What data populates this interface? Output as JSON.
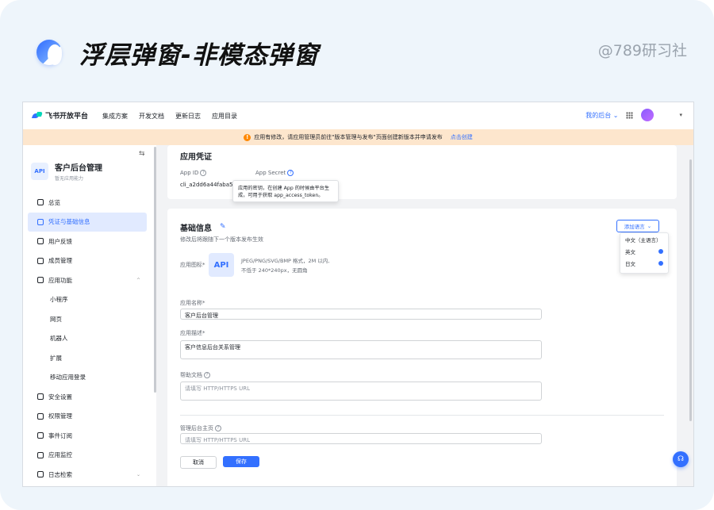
{
  "header": {
    "title": "浮层弹窗-非模态弹窗",
    "watermark": "@789研习社"
  },
  "topnav": {
    "brand": "飞书开放平台",
    "links": [
      "集成方案",
      "开发文档",
      "更新日志",
      "应用目录"
    ],
    "my_backend": "我的后台",
    "expand_caret": "▾"
  },
  "banner": {
    "text": "应用有修改，请应用管理员前往\"版本管理与发布\"页面创建新版本并申请发布",
    "link": "点击创建"
  },
  "sidebar": {
    "app_name": "客户后台管理",
    "app_sub": "暂无应用能力",
    "app_logo": "API",
    "items": [
      {
        "label": "总览"
      },
      {
        "label": "凭证与基础信息"
      },
      {
        "label": "用户反馈"
      },
      {
        "label": "成员管理"
      },
      {
        "label": "应用功能"
      },
      {
        "label": "小程序"
      },
      {
        "label": "网页"
      },
      {
        "label": "机器人"
      },
      {
        "label": "扩展"
      },
      {
        "label": "移动应用登录"
      },
      {
        "label": "安全设置"
      },
      {
        "label": "权限管理"
      },
      {
        "label": "事件订阅"
      },
      {
        "label": "应用监控"
      },
      {
        "label": "日志检索"
      }
    ]
  },
  "credentials": {
    "title": "应用凭证",
    "app_id_label": "App ID",
    "app_id_value": "cli_a2dd6a44faba500e",
    "app_secret_label": "App Secret",
    "tooltip_line1": "应用的密钥，在创建 App 的时候由平台生",
    "tooltip_line2": "成，可用于获取 app_access_token。"
  },
  "basic": {
    "title": "基础信息",
    "subtitle": "修改后将跟随下一个版本发布生效",
    "add_lang": "添加语言",
    "langs": [
      "中文（主语言）",
      "英文",
      "日文"
    ],
    "icon_label": "应用图标*",
    "icon_text": "API",
    "icon_hint1": "JPEG/PNG/SVG/BMP 格式，2M 以内,",
    "icon_hint2": "不低于 240*240px，无圆角",
    "name_label": "应用名称*",
    "name_value": "客户后台管理",
    "desc_label": "应用描述*",
    "desc_value": "客户信息后台关系管理",
    "help_label": "帮助文档",
    "help_placeholder": "请填写 HTTP/HTTPS URL",
    "home_label": "管理后台主页",
    "home_placeholder": "请填写 HTTP/HTTPS URL",
    "cancel": "取消",
    "save": "保存"
  }
}
